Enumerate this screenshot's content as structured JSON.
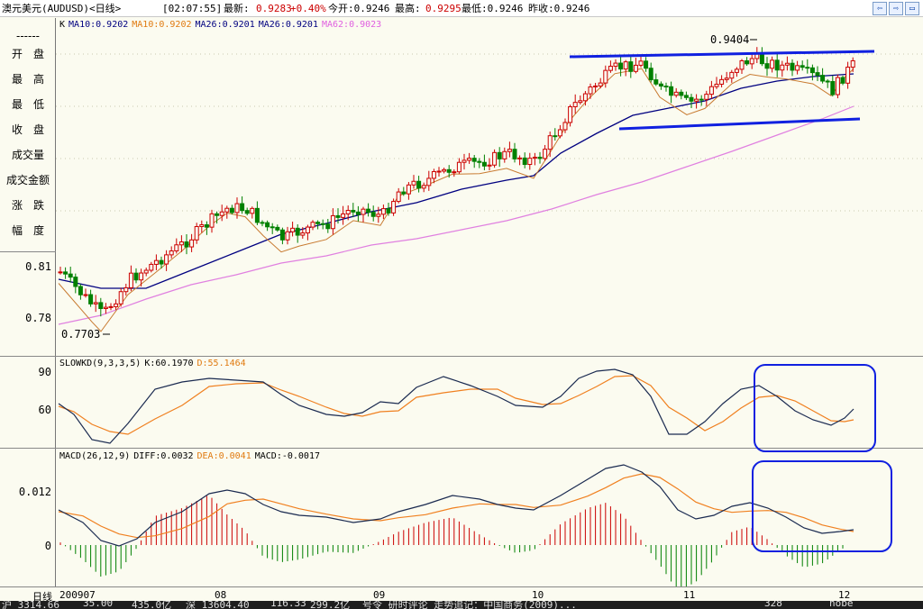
{
  "title_bar": {
    "name": "澳元美元(AUDUSD)<日线>",
    "time": "[02:07:55]",
    "latest_label": "最新:",
    "latest_value": "0.9283",
    "change": "+0.40%",
    "open": "今开:0.9246",
    "high_label": "最高:",
    "high_value": "0.9295",
    "low": "最低:0.9246",
    "prev_close": "昨收:0.9246",
    "buttons": [
      "⇦",
      "⇨",
      "▭"
    ]
  },
  "side_panel": {
    "labels": [
      "开　盘",
      "最　高",
      "最　低",
      "收　盘",
      "成交量",
      "成交金额",
      "涨　跌",
      "幅　度"
    ],
    "dashes": "------"
  },
  "price_panel": {
    "legend_k": "K",
    "legend": [
      {
        "text": "MA10:0.9202",
        "color": "#000080"
      },
      {
        "text": "MA10:0.9202",
        "color": "#e07a10"
      },
      {
        "text": "MA26:0.9201",
        "color": "#000080"
      },
      {
        "text": "MA26:0.9201",
        "color": "#000080"
      },
      {
        "text": "MA62:0.9023",
        "color": "#e060e0"
      }
    ],
    "y_ticks": [
      "0.81",
      "0.78"
    ],
    "high_annotation": "0.9404",
    "low_annotation": "0.7703"
  },
  "kd_panel": {
    "legend": [
      {
        "text": "SLOWKD(9,3,3,5)",
        "color": "#000000"
      },
      {
        "text": "K:60.1970",
        "color": "#000000"
      },
      {
        "text": "D:55.1464",
        "color": "#e07a10"
      }
    ],
    "y_ticks": [
      "90",
      "60"
    ]
  },
  "macd_panel": {
    "legend": [
      {
        "text": "MACD(26,12,9)",
        "color": "#000000"
      },
      {
        "text": "DIFF:0.0032",
        "color": "#000000"
      },
      {
        "text": "DEA:0.0041",
        "color": "#e07a10"
      },
      {
        "text": "MACD:-0.0017",
        "color": "#000000"
      }
    ],
    "y_ticks": [
      "0.012",
      "0"
    ]
  },
  "x_axis": {
    "label": "日线",
    "ticks": [
      "200907",
      "08",
      "09",
      "10",
      "11",
      "12"
    ]
  },
  "status_bar": {
    "items": [
      "沪 3314.66",
      "35.00",
      "435.0亿",
      "深 13604.40",
      "116.33",
      "299.2亿",
      "号令 研时评论 走势追记：中国商务(2009)...",
      "328",
      "nobe"
    ]
  },
  "colors": {
    "up": "#cc0000",
    "down": "#008000",
    "ma10": "#c87a30",
    "ma26": "#000080",
    "ma62": "#e080e0",
    "annotation_blue": "#1020e0",
    "k_line": "#1a2a50",
    "d_line": "#f08020"
  },
  "chart_data": [
    {
      "type": "candlestick",
      "title": "澳元美元(AUDUSD)<日线>",
      "x_range": [
        "2009-07",
        "2009-12"
      ],
      "y_range": [
        0.765,
        0.945
      ],
      "annotations": {
        "high": 0.9404,
        "low": 0.7703
      },
      "series": [
        {
          "name": "MA10",
          "latest": 0.9202
        },
        {
          "name": "MA26",
          "latest": 0.9201
        },
        {
          "name": "MA62",
          "latest": 0.9023
        }
      ]
    },
    {
      "type": "line",
      "title": "SLOWKD(9,3,3,5)",
      "y_ticks": [
        60,
        90
      ],
      "series": [
        {
          "name": "K",
          "latest": 60.197
        },
        {
          "name": "D",
          "latest": 55.1464
        }
      ]
    },
    {
      "type": "bar",
      "title": "MACD(26,12,9)",
      "y_ticks": [
        0,
        0.012
      ],
      "series": [
        {
          "name": "DIFF",
          "latest": 0.0032
        },
        {
          "name": "DEA",
          "latest": 0.0041
        },
        {
          "name": "MACD",
          "latest": -0.0017
        }
      ]
    }
  ]
}
